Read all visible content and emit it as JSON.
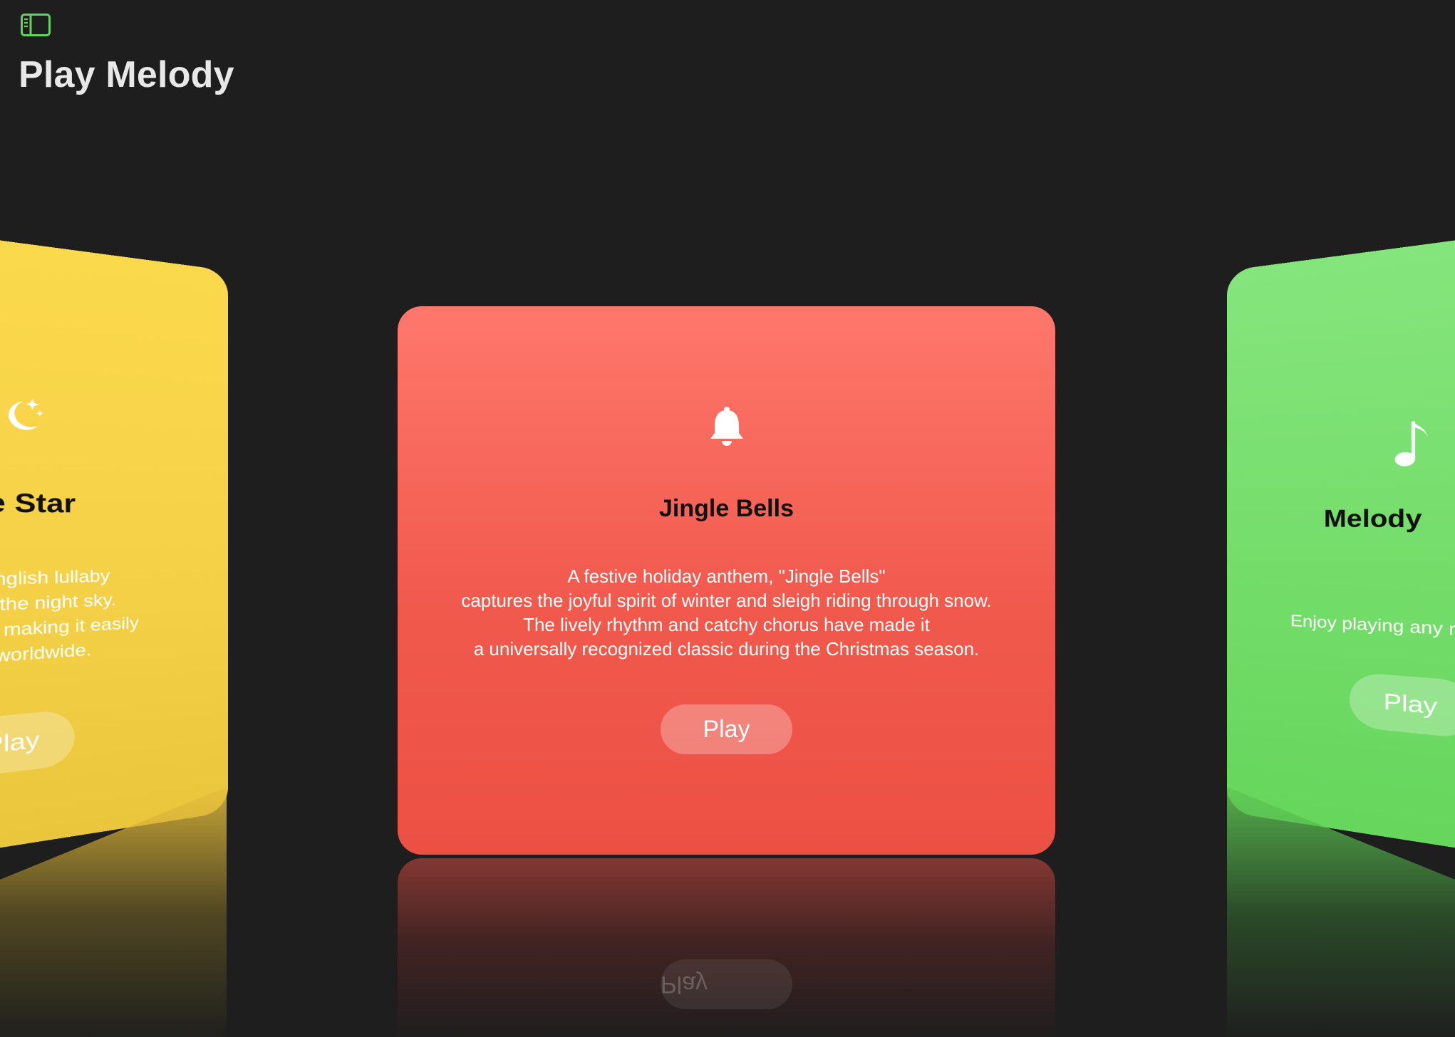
{
  "app": {
    "title": "Play Melody"
  },
  "toolbar": {
    "sidebar_toggle_icon": "sidebar-left-icon",
    "accent_color": "#5fd35a"
  },
  "cards": {
    "left": {
      "icon": "moon-stars-icon",
      "title": "Twinkle Twinkle Little Star",
      "visible_title": "le Twinkle Little Star",
      "description": [
        "Little Star\" is a classic English lullaby",
        "onder of a shining star in the night sky.",
        "melody and repetitive lyrics, making it easily",
        "d beloved by children worldwide."
      ],
      "play_label": "Play",
      "color": "#f6d349"
    },
    "center": {
      "icon": "bell-icon",
      "title": "Jingle Bells",
      "description": [
        "A festive holiday anthem, \"Jingle Bells\"",
        "captures the joyful spirit of winter and sleigh riding through snow.",
        "The lively rhythm and catchy chorus have made it",
        "a universally recognized classic during the Christmas season."
      ],
      "play_label": "Play",
      "color": "#f0564a"
    },
    "right": {
      "icon": "music-note-icon",
      "title": "Melody",
      "description": [
        "Enjoy playing any melody y"
      ],
      "play_label": "Play",
      "color": "#6fda65"
    }
  }
}
